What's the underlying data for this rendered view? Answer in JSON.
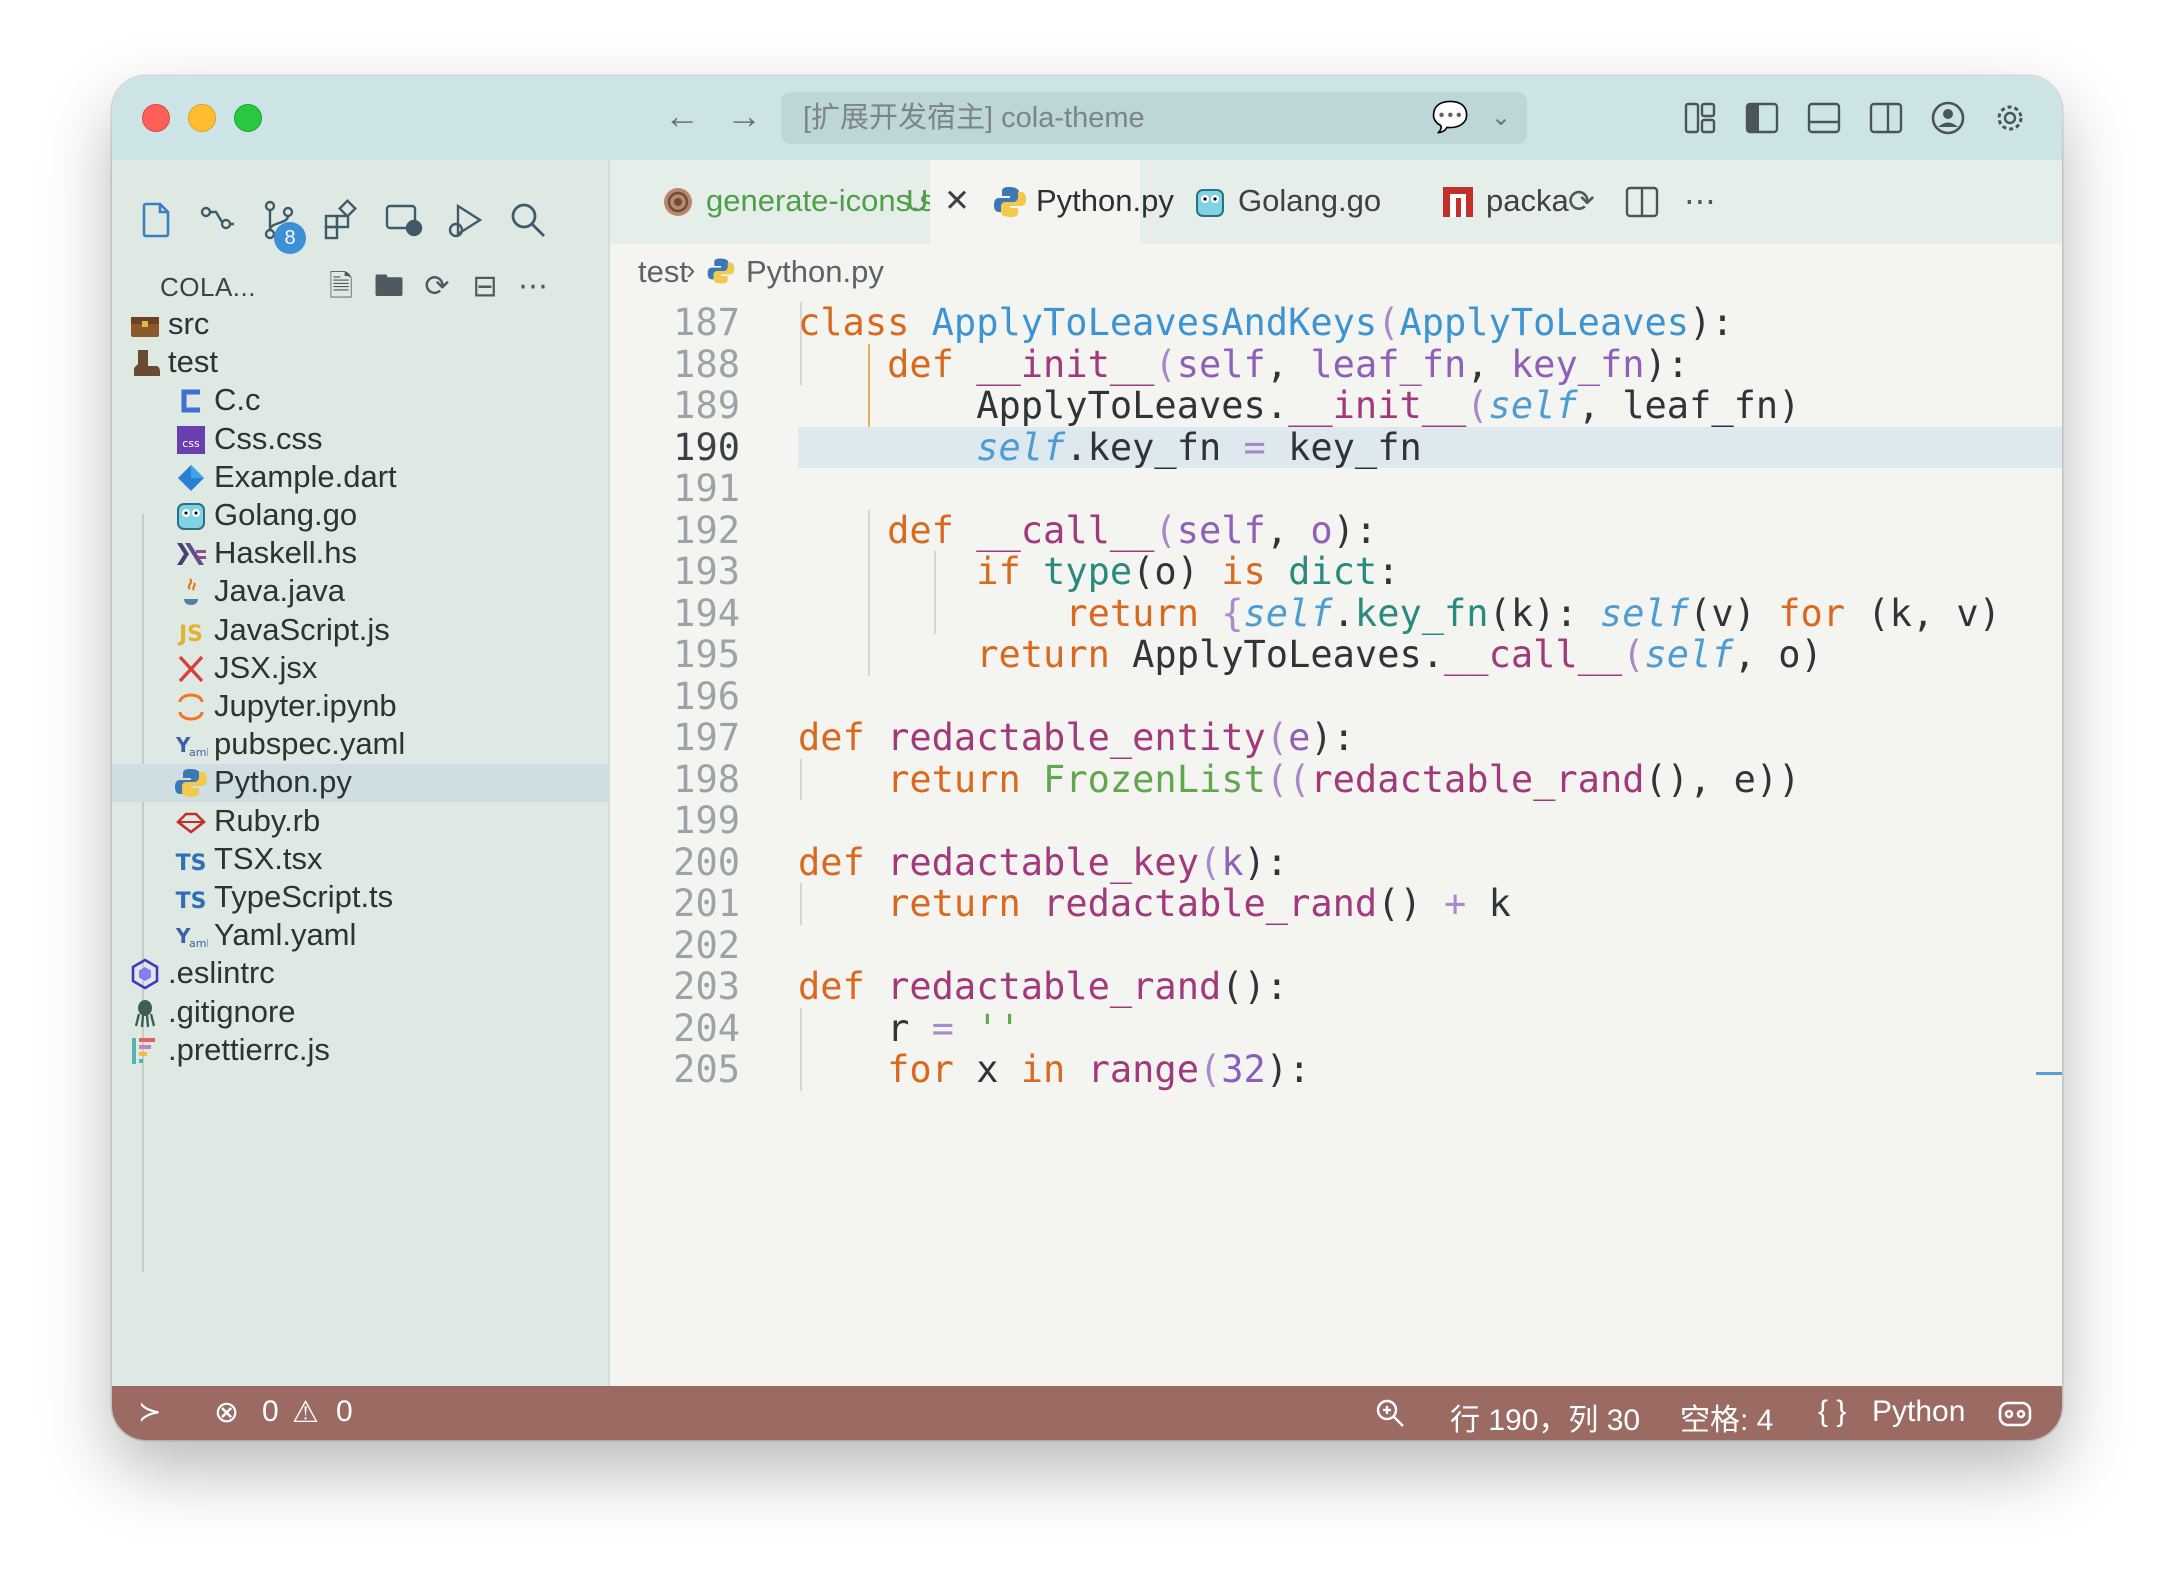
{
  "window": {
    "title": "[扩展开发宿主] cola-theme",
    "colors": {
      "titlebar": "#cde4e6",
      "sidebar": "#dfe9e4",
      "editor": "#f4f5f1",
      "statusbar": "#9b6a63",
      "selection": "#dde9ee"
    }
  },
  "sidebar": {
    "badge_count": "8",
    "explorer_title": "COLA...",
    "tree": [
      {
        "label": "src",
        "icon": "folder-chest-icon",
        "level": 0
      },
      {
        "label": "test",
        "icon": "folder-boot-icon",
        "level": 0
      },
      {
        "label": "C.c",
        "icon": "c-icon",
        "level": 1
      },
      {
        "label": "Css.css",
        "icon": "css-icon",
        "level": 1
      },
      {
        "label": "Example.dart",
        "icon": "dart-icon",
        "level": 1
      },
      {
        "label": "Golang.go",
        "icon": "gopher-icon",
        "level": 1
      },
      {
        "label": "Haskell.hs",
        "icon": "haskell-icon",
        "level": 1
      },
      {
        "label": "Java.java",
        "icon": "java-icon",
        "level": 1
      },
      {
        "label": "JavaScript.js",
        "icon": "javascript-icon",
        "level": 1
      },
      {
        "label": "JSX.jsx",
        "icon": "jsx-icon",
        "level": 1
      },
      {
        "label": "Jupyter.ipynb",
        "icon": "jupyter-icon",
        "level": 1
      },
      {
        "label": "pubspec.yaml",
        "icon": "yaml-icon",
        "level": 1
      },
      {
        "label": "Python.py",
        "icon": "python-icon",
        "level": 1,
        "selected": true
      },
      {
        "label": "Ruby.rb",
        "icon": "ruby-icon",
        "level": 1
      },
      {
        "label": "TSX.tsx",
        "icon": "typescript-icon",
        "level": 1
      },
      {
        "label": "TypeScript.ts",
        "icon": "typescript-icon",
        "level": 1
      },
      {
        "label": "Yaml.yaml",
        "icon": "yaml-icon",
        "level": 1
      },
      {
        "label": ".eslintrc",
        "icon": "eslint-icon",
        "level": 0
      },
      {
        "label": ".gitignore",
        "icon": "git-icon",
        "level": 0
      },
      {
        "label": ".prettierrc.js",
        "icon": "prettier-icon",
        "level": 0
      }
    ]
  },
  "tabs": [
    {
      "label": "generate-icons.sh",
      "status": "U",
      "icon": "shell-icon",
      "active": false
    },
    {
      "label": "Python.py",
      "icon": "python-icon",
      "active": true
    },
    {
      "label": "Golang.go",
      "icon": "gopher-icon",
      "active": false
    },
    {
      "label": "packa",
      "icon": "npm-icon",
      "active": false
    }
  ],
  "breadcrumb": {
    "folder": "test",
    "file": "Python.py"
  },
  "editor": {
    "current_line": 190,
    "lines": [
      {
        "n": "187",
        "tokens": [
          [
            "class ",
            "k"
          ],
          [
            "ApplyToLeavesAndKeys",
            "c"
          ],
          [
            "(",
            "o"
          ],
          [
            "ApplyToLeaves",
            "c"
          ],
          [
            "):",
            ""
          ]
        ]
      },
      {
        "n": "188",
        "tokens": [
          [
            "    ",
            ""
          ],
          [
            "def ",
            "k"
          ],
          [
            "__init__",
            "f"
          ],
          [
            "(",
            "o"
          ],
          [
            "self",
            "p"
          ],
          [
            ", ",
            ""
          ],
          [
            "leaf_fn",
            "p"
          ],
          [
            ", ",
            ""
          ],
          [
            "key_fn",
            "p"
          ],
          [
            "):",
            ""
          ]
        ]
      },
      {
        "n": "189",
        "tokens": [
          [
            "        ApplyToLeaves.",
            ""
          ],
          [
            "__init__",
            "f"
          ],
          [
            "(",
            "o"
          ],
          [
            "self",
            "s"
          ],
          [
            ", leaf_fn)",
            ""
          ]
        ]
      },
      {
        "n": "190",
        "tokens": [
          [
            "        ",
            ""
          ],
          [
            "self",
            "s"
          ],
          [
            ".key_fn ",
            ""
          ],
          [
            "=",
            "o"
          ],
          [
            " key_fn",
            ""
          ]
        ]
      },
      {
        "n": "191",
        "tokens": []
      },
      {
        "n": "192",
        "tokens": [
          [
            "    ",
            ""
          ],
          [
            "def ",
            "k"
          ],
          [
            "__call__",
            "f"
          ],
          [
            "(",
            "o"
          ],
          [
            "self",
            "p"
          ],
          [
            ", ",
            ""
          ],
          [
            "o",
            "p"
          ],
          [
            "):",
            ""
          ]
        ]
      },
      {
        "n": "193",
        "tokens": [
          [
            "        ",
            ""
          ],
          [
            "if ",
            "k"
          ],
          [
            "type",
            "b"
          ],
          [
            "(o) ",
            ""
          ],
          [
            "is ",
            "k"
          ],
          [
            "dict",
            "b"
          ],
          [
            ":",
            ""
          ]
        ]
      },
      {
        "n": "194",
        "tokens": [
          [
            "            ",
            ""
          ],
          [
            "return ",
            "k"
          ],
          [
            "{",
            "o"
          ],
          [
            "self",
            "s"
          ],
          [
            ".",
            ""
          ],
          [
            "key_fn",
            "b"
          ],
          [
            "(k): ",
            ""
          ],
          [
            "self",
            "s"
          ],
          [
            "(v) ",
            ""
          ],
          [
            "for ",
            "k"
          ],
          [
            "(k, v)",
            ""
          ]
        ]
      },
      {
        "n": "195",
        "tokens": [
          [
            "        ",
            ""
          ],
          [
            "return ",
            "k"
          ],
          [
            "ApplyToLeaves.",
            ""
          ],
          [
            "__call__",
            "f"
          ],
          [
            "(",
            "o"
          ],
          [
            "self",
            "s"
          ],
          [
            ", o)",
            ""
          ]
        ]
      },
      {
        "n": "196",
        "tokens": []
      },
      {
        "n": "197",
        "tokens": [
          [
            "def ",
            "k"
          ],
          [
            "redactable_entity",
            "f"
          ],
          [
            "(",
            "o"
          ],
          [
            "e",
            "p"
          ],
          [
            "):",
            ""
          ]
        ]
      },
      {
        "n": "198",
        "tokens": [
          [
            "    ",
            ""
          ],
          [
            "return ",
            "k"
          ],
          [
            "FrozenList",
            "g"
          ],
          [
            "((",
            "o"
          ],
          [
            "redactable_rand",
            "f"
          ],
          [
            "(), e))",
            ""
          ]
        ]
      },
      {
        "n": "199",
        "tokens": []
      },
      {
        "n": "200",
        "tokens": [
          [
            "def ",
            "k"
          ],
          [
            "redactable_key",
            "f"
          ],
          [
            "(",
            "o"
          ],
          [
            "k",
            "p"
          ],
          [
            "):",
            ""
          ]
        ]
      },
      {
        "n": "201",
        "tokens": [
          [
            "    ",
            ""
          ],
          [
            "return ",
            "k"
          ],
          [
            "redactable_rand",
            "f"
          ],
          [
            "() ",
            ""
          ],
          [
            "+",
            "o"
          ],
          [
            " k",
            ""
          ]
        ]
      },
      {
        "n": "202",
        "tokens": []
      },
      {
        "n": "203",
        "tokens": [
          [
            "def ",
            "k"
          ],
          [
            "redactable_rand",
            "f"
          ],
          [
            "():",
            ""
          ]
        ]
      },
      {
        "n": "204",
        "tokens": [
          [
            "    r ",
            ""
          ],
          [
            "=",
            "o"
          ],
          [
            " ",
            ""
          ],
          [
            "''",
            "g"
          ]
        ]
      },
      {
        "n": "205",
        "tokens": [
          [
            "    ",
            ""
          ],
          [
            "for ",
            "k"
          ],
          [
            "x ",
            ""
          ],
          [
            "in ",
            "k"
          ],
          [
            "range",
            "f"
          ],
          [
            "(",
            "o"
          ],
          [
            "32",
            "n"
          ],
          [
            "):",
            ""
          ]
        ]
      }
    ]
  },
  "statusbar": {
    "errors": "0",
    "warnings": "0",
    "position": "行 190，列 30",
    "indent": "空格: 4",
    "language": "Python",
    "language_braces": "{ }"
  }
}
